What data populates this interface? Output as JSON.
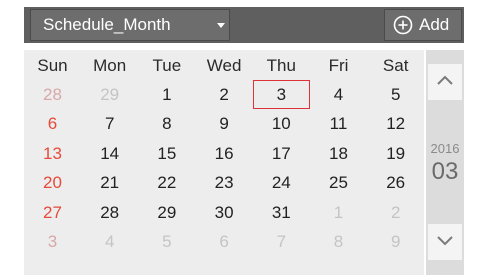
{
  "header": {
    "view_label": "Schedule_Month",
    "add_label": "Add"
  },
  "weekdays": [
    "Sun",
    "Mon",
    "Tue",
    "Wed",
    "Thu",
    "Fri",
    "Sat"
  ],
  "weeks": [
    [
      {
        "d": "28",
        "out": true
      },
      {
        "d": "29",
        "out": true
      },
      {
        "d": "1"
      },
      {
        "d": "2"
      },
      {
        "d": "3",
        "today": true
      },
      {
        "d": "4"
      },
      {
        "d": "5"
      }
    ],
    [
      {
        "d": "6"
      },
      {
        "d": "7"
      },
      {
        "d": "8"
      },
      {
        "d": "9"
      },
      {
        "d": "10"
      },
      {
        "d": "11"
      },
      {
        "d": "12"
      }
    ],
    [
      {
        "d": "13"
      },
      {
        "d": "14"
      },
      {
        "d": "15"
      },
      {
        "d": "16"
      },
      {
        "d": "17"
      },
      {
        "d": "18"
      },
      {
        "d": "19"
      }
    ],
    [
      {
        "d": "20"
      },
      {
        "d": "21"
      },
      {
        "d": "22"
      },
      {
        "d": "23"
      },
      {
        "d": "24"
      },
      {
        "d": "25"
      },
      {
        "d": "26"
      }
    ],
    [
      {
        "d": "27"
      },
      {
        "d": "28"
      },
      {
        "d": "29"
      },
      {
        "d": "30"
      },
      {
        "d": "31"
      },
      {
        "d": "1",
        "out": true
      },
      {
        "d": "2",
        "out": true
      }
    ],
    [
      {
        "d": "3",
        "out": true
      },
      {
        "d": "4",
        "out": true
      },
      {
        "d": "5",
        "out": true
      },
      {
        "d": "6",
        "out": true
      },
      {
        "d": "7",
        "out": true
      },
      {
        "d": "8",
        "out": true
      },
      {
        "d": "9",
        "out": true
      }
    ]
  ],
  "side": {
    "year": "2016",
    "month": "03",
    "prev_icon": "chevron-up-icon",
    "next_icon": "chevron-down-icon"
  },
  "colors": {
    "sunday": "#e64a3a",
    "today_border": "#e0303a",
    "header_bg": "#5f5f5f"
  }
}
